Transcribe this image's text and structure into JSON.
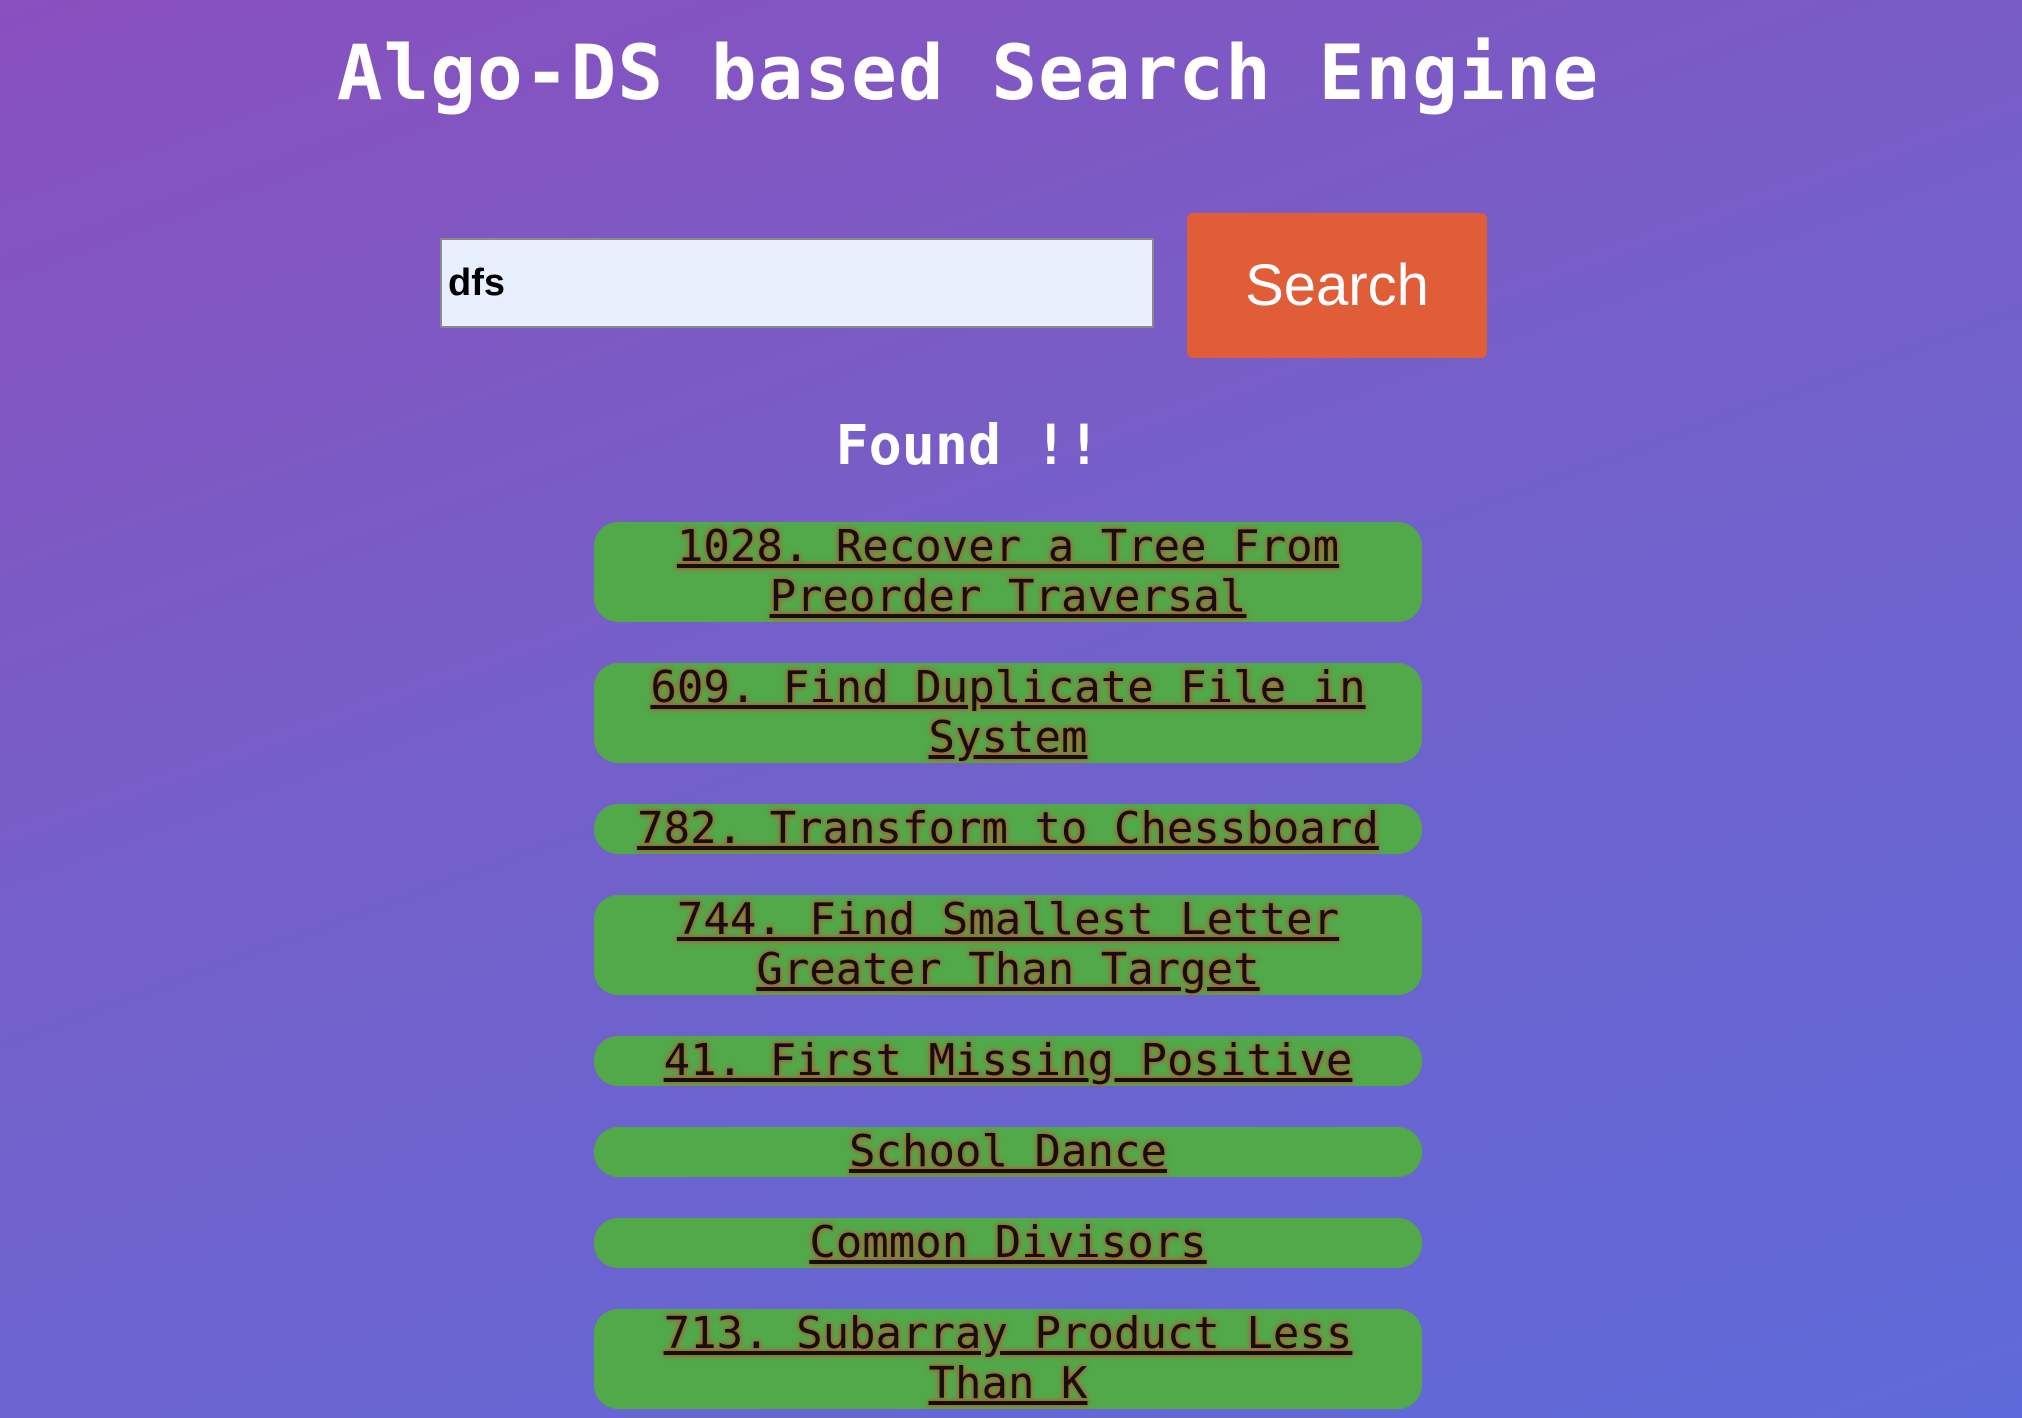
{
  "header": {
    "title": "Algo-DS based Search Engine"
  },
  "search": {
    "value": "dfs",
    "button_label": "Search"
  },
  "results": {
    "heading": "Found !!",
    "items": [
      {
        "label": "1028. Recover a Tree From Preorder Traversal"
      },
      {
        "label": "609. Find Duplicate File in System"
      },
      {
        "label": "782. Transform to Chessboard"
      },
      {
        "label": "744. Find Smallest Letter Greater Than Target"
      },
      {
        "label": "41. First Missing Positive"
      },
      {
        "label": "School Dance"
      },
      {
        "label": "Common Divisors"
      },
      {
        "label": "713. Subarray Product Less Than K"
      }
    ]
  },
  "colors": {
    "background_start": "#8950be",
    "background_end": "#5e6ad9",
    "button": "#e05d38",
    "result_pill": "#51a94a",
    "input_background": "#e8f0fe"
  }
}
